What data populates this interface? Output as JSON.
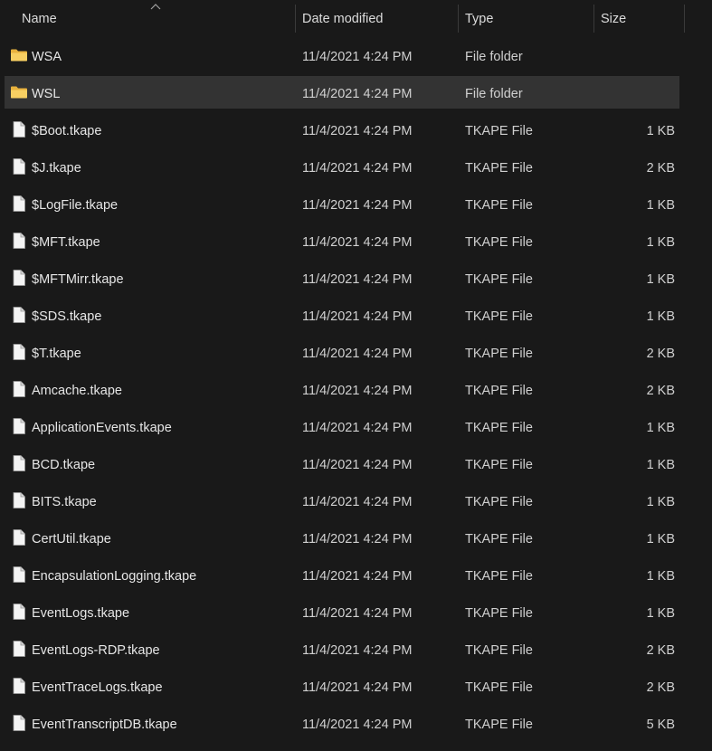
{
  "columns": {
    "name": "Name",
    "date_modified": "Date modified",
    "type": "Type",
    "size": "Size"
  },
  "colors": {
    "background": "#191919",
    "selected_row": "#333333",
    "folder": "#f2c55c",
    "file_icon": "#f2f2f2"
  },
  "rows": [
    {
      "name": "WSA",
      "date": "11/4/2021 4:24 PM",
      "type": "File folder",
      "size": "",
      "icon": "folder-icon"
    },
    {
      "name": "WSL",
      "date": "11/4/2021 4:24 PM",
      "type": "File folder",
      "size": "",
      "icon": "folder-icon",
      "selected": true
    },
    {
      "name": "$Boot.tkape",
      "date": "11/4/2021 4:24 PM",
      "type": "TKAPE File",
      "size": "1 KB",
      "icon": "file-icon"
    },
    {
      "name": "$J.tkape",
      "date": "11/4/2021 4:24 PM",
      "type": "TKAPE File",
      "size": "2 KB",
      "icon": "file-icon"
    },
    {
      "name": "$LogFile.tkape",
      "date": "11/4/2021 4:24 PM",
      "type": "TKAPE File",
      "size": "1 KB",
      "icon": "file-icon"
    },
    {
      "name": "$MFT.tkape",
      "date": "11/4/2021 4:24 PM",
      "type": "TKAPE File",
      "size": "1 KB",
      "icon": "file-icon"
    },
    {
      "name": "$MFTMirr.tkape",
      "date": "11/4/2021 4:24 PM",
      "type": "TKAPE File",
      "size": "1 KB",
      "icon": "file-icon"
    },
    {
      "name": "$SDS.tkape",
      "date": "11/4/2021 4:24 PM",
      "type": "TKAPE File",
      "size": "1 KB",
      "icon": "file-icon"
    },
    {
      "name": "$T.tkape",
      "date": "11/4/2021 4:24 PM",
      "type": "TKAPE File",
      "size": "2 KB",
      "icon": "file-icon"
    },
    {
      "name": "Amcache.tkape",
      "date": "11/4/2021 4:24 PM",
      "type": "TKAPE File",
      "size": "2 KB",
      "icon": "file-icon"
    },
    {
      "name": "ApplicationEvents.tkape",
      "date": "11/4/2021 4:24 PM",
      "type": "TKAPE File",
      "size": "1 KB",
      "icon": "file-icon"
    },
    {
      "name": "BCD.tkape",
      "date": "11/4/2021 4:24 PM",
      "type": "TKAPE File",
      "size": "1 KB",
      "icon": "file-icon"
    },
    {
      "name": "BITS.tkape",
      "date": "11/4/2021 4:24 PM",
      "type": "TKAPE File",
      "size": "1 KB",
      "icon": "file-icon"
    },
    {
      "name": "CertUtil.tkape",
      "date": "11/4/2021 4:24 PM",
      "type": "TKAPE File",
      "size": "1 KB",
      "icon": "file-icon"
    },
    {
      "name": "EncapsulationLogging.tkape",
      "date": "11/4/2021 4:24 PM",
      "type": "TKAPE File",
      "size": "1 KB",
      "icon": "file-icon"
    },
    {
      "name": "EventLogs.tkape",
      "date": "11/4/2021 4:24 PM",
      "type": "TKAPE File",
      "size": "1 KB",
      "icon": "file-icon"
    },
    {
      "name": "EventLogs-RDP.tkape",
      "date": "11/4/2021 4:24 PM",
      "type": "TKAPE File",
      "size": "2 KB",
      "icon": "file-icon"
    },
    {
      "name": "EventTraceLogs.tkape",
      "date": "11/4/2021 4:24 PM",
      "type": "TKAPE File",
      "size": "2 KB",
      "icon": "file-icon"
    },
    {
      "name": "EventTranscriptDB.tkape",
      "date": "11/4/2021 4:24 PM",
      "type": "TKAPE File",
      "size": "5 KB",
      "icon": "file-icon"
    }
  ]
}
